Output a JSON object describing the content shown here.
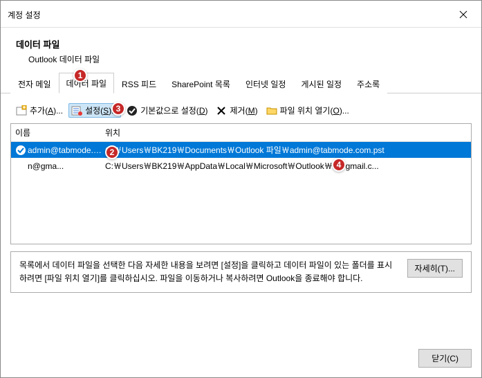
{
  "dialog": {
    "title": "계정 설정"
  },
  "header": {
    "title": "데이터 파일",
    "subtitle": "Outlook 데이터 파일"
  },
  "tabs": [
    {
      "label": "전자 메일",
      "active": false
    },
    {
      "label": "데이터 파일",
      "active": true
    },
    {
      "label": "RSS 피드",
      "active": false
    },
    {
      "label": "SharePoint 목록",
      "active": false
    },
    {
      "label": "인터넷 일정",
      "active": false
    },
    {
      "label": "게시된 일정",
      "active": false
    },
    {
      "label": "주소록",
      "active": false
    }
  ],
  "toolbar": {
    "add": {
      "label": "추가(",
      "key": "A",
      "suffix": ")..."
    },
    "settings": {
      "label": "설정(",
      "key": "S",
      "suffix": ")..."
    },
    "default": {
      "label": "기본값으로 설정(",
      "key": "D",
      "suffix": ")"
    },
    "remove": {
      "label": "제거(",
      "key": "M",
      "suffix": ")"
    },
    "openLocation": {
      "label": "파일 위치 열기(",
      "key": "O",
      "suffix": ")..."
    }
  },
  "list": {
    "columns": {
      "name": "이름",
      "path": "위치"
    },
    "rows": [
      {
        "name": "admin@tabmode.com",
        "path": "C:￦Users￦BK219￦Documents￦Outlook 파일￦admin@tabmode.com.pst",
        "selected": true,
        "default": true
      },
      {
        "name": "n@gma...",
        "path": "C:￦Users￦BK219￦AppData￦Local￦Microsoft￦Outlook￦n@gmail.c...",
        "selected": false,
        "default": false
      }
    ]
  },
  "hint": {
    "text": "목록에서 데이터 파일을 선택한 다음 자세한 내용을 보려면 [설정]을 클릭하고 데이터 파일이 있는 폴더를 표시하려면 [파일 위치 열기]를 클릭하십시오. 파일을 이동하거나 복사하려면 Outlook을 종료해야 합니다.",
    "button": {
      "label": "자세히(",
      "key": "T",
      "suffix": ")..."
    }
  },
  "footer": {
    "close": {
      "label": "닫기(",
      "key": "C",
      "suffix": ")"
    }
  },
  "annotations": [
    "1",
    "2",
    "3",
    "4"
  ]
}
